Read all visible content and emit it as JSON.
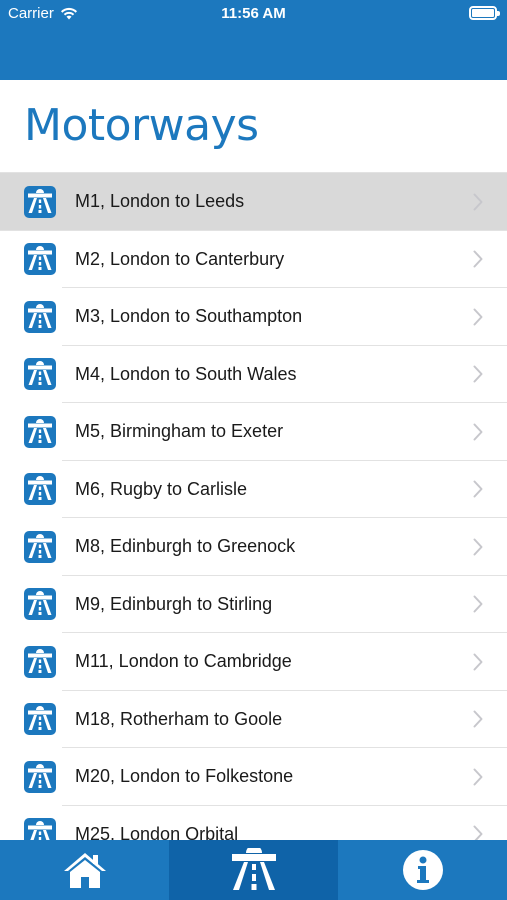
{
  "status_bar": {
    "carrier": "Carrier",
    "time": "11:56 AM"
  },
  "header": {
    "title": "Motorways"
  },
  "motorways": [
    {
      "label": "M1, London to Leeds",
      "selected": true
    },
    {
      "label": "M2, London to Canterbury"
    },
    {
      "label": "M3, London to Southampton"
    },
    {
      "label": "M4, London to South Wales"
    },
    {
      "label": "M5, Birmingham to Exeter"
    },
    {
      "label": "M6, Rugby to Carlisle"
    },
    {
      "label": "M8, Edinburgh to Greenock"
    },
    {
      "label": "M9, Edinburgh to Stirling"
    },
    {
      "label": "M11, London to Cambridge"
    },
    {
      "label": "M18, Rotherham to Goole"
    },
    {
      "label": "M20, London to Folkestone"
    },
    {
      "label": "M25, London Orbital"
    }
  ],
  "tabs": [
    {
      "name": "home",
      "icon": "home-icon"
    },
    {
      "name": "motorways",
      "icon": "motorway-icon",
      "active": true
    },
    {
      "name": "info",
      "icon": "info-icon"
    }
  ],
  "colors": {
    "brand_blue": "#1c78be",
    "active_tab": "#0f63a8",
    "selected_row": "#d9d9d9"
  }
}
